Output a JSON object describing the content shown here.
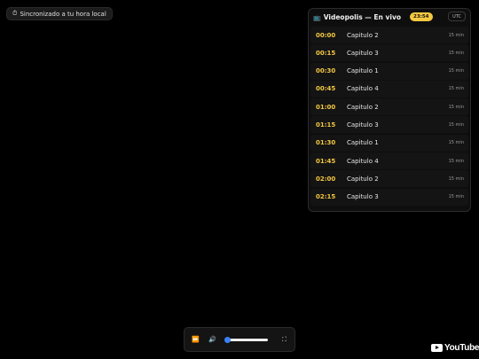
{
  "sync_badge": {
    "icon": "⏱",
    "text": "Sincronizado a tu hora local"
  },
  "schedule": {
    "tv_icon": "📺",
    "title": "Videopolis — En vivo",
    "clock": "23:54",
    "timezone": "UTC",
    "accent_color": "#f4c842",
    "items": [
      {
        "time": "00:00",
        "title": "Capitulo 2",
        "duration": "15 min"
      },
      {
        "time": "00:15",
        "title": "Capitulo 3",
        "duration": "15 min"
      },
      {
        "time": "00:30",
        "title": "Capitulo 1",
        "duration": "15 min"
      },
      {
        "time": "00:45",
        "title": "Capitulo 4",
        "duration": "15 min"
      },
      {
        "time": "01:00",
        "title": "Capitulo 2",
        "duration": "15 min"
      },
      {
        "time": "01:15",
        "title": "Capitulo 3",
        "duration": "15 min"
      },
      {
        "time": "01:30",
        "title": "Capitulo 1",
        "duration": "15 min"
      },
      {
        "time": "01:45",
        "title": "Capitulo 4",
        "duration": "15 min"
      },
      {
        "time": "02:00",
        "title": "Capitulo 2",
        "duration": "15 min"
      },
      {
        "time": "02:15",
        "title": "Capitulo 3",
        "duration": "15 min"
      }
    ]
  },
  "player": {
    "play_icon": "⏩",
    "volume_icon": "🔊",
    "volume_level": 0.05,
    "fullscreen_icon": "⛶"
  },
  "watermark": {
    "text": "YouTube"
  }
}
